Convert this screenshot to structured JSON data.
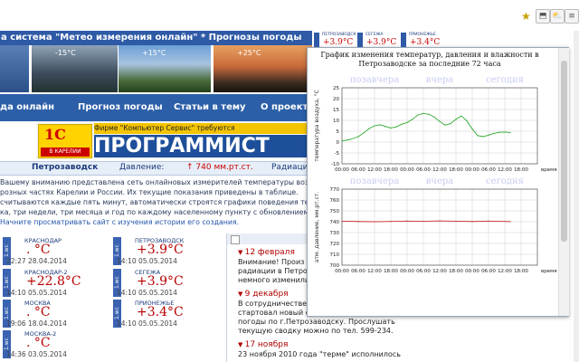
{
  "site": {
    "banner_title": "а система \"Метео измерения онлайн\" * Прогнозы погоды",
    "photos": [
      {
        "temp": "-15°C"
      },
      {
        "temp": "+15°C"
      },
      {
        "temp": "+25°C"
      }
    ],
    "nav": [
      "да онлайн",
      "Прогноз погоды",
      "Статьи в тему",
      "О проект"
    ],
    "ad": {
      "logo_text": "1С",
      "logo_sub": "В КАРЕЛИИ",
      "strip": "Фирме \"Компьютер Сервис\" требуются",
      "big": "ПРОГРАММИСТ"
    },
    "info": {
      "city": "Петрозаводск",
      "pressure_label": "Давление:",
      "pressure_value": "↑ 740 мм.рт.ст.",
      "radiation_label": "Радиацио"
    },
    "intro_lines": [
      "Вашему вниманию представлена сеть онлайновых измерителей температуры воз",
      "розных частях Карелии и России. Их текущие показания приведены в таблице.",
      "считываются каждые пять минут, автоматически строятся графики поведения темпе",
      "ка, три недели, три месяца и год по каждому населенному пункту с обновлением раз",
      "Начните просматривать сайт с изучения истории его создания."
    ]
  },
  "stations": [
    {
      "tag": "1.wc",
      "name": "КРАСНОДАР",
      "value": ". °C",
      "time": "22:27 28.04.2014"
    },
    {
      "tag": "1.wc",
      "name": "ПЕТРОЗАВОДСК",
      "value": "+3.9°C",
      "time": "14:10 05.05.2014"
    },
    {
      "tag": "1.wc",
      "name": "КРАСНОДАР-2",
      "value": "+22.8°C",
      "time": "14:10 05.05.2014"
    },
    {
      "tag": "1.wc",
      "name": "СЕГЕЖА",
      "value": "+3.9°C",
      "time": "14:10 05.05.2014"
    },
    {
      "tag": "1.wc",
      "name": "МОСКВА",
      "value": ". °C",
      "time": "19:06 18.04.2014"
    },
    {
      "tag": "1.wc",
      "name": "ПРИОНЕЖЬЕ",
      "value": "+3.4°C",
      "time": "14:10 05.05.2014"
    },
    {
      "tag": "1.wc",
      "name": "МОСКВА-2",
      "value": ". °C",
      "time": "14:36 03.05.2014"
    }
  ],
  "news": [
    {
      "date": "12 февраля",
      "text": [
        "Внимание! Произ",
        "радиации в Петро",
        "немного изменили"
      ]
    },
    {
      "date": "9 декабря",
      "text": [
        "В сотрудничестве с ООО \"Медтех\" ИКС",
        "стартовал новый сервис автоинформатора",
        "погоды по г.Петрозаводску. Прослушать",
        "текущую сводку можно по тел. 599-234."
      ]
    },
    {
      "date": "17 ноября",
      "text": [
        "23 ноября 2010 года \"терме\" исполнилось"
      ]
    }
  ],
  "badges": [
    {
      "name": "ПЕТРОЗАВОДСК",
      "value": "+3.9°C"
    },
    {
      "name": "СЕГЕЖА",
      "value": "+3.9°C"
    },
    {
      "name": "ПРИОНЕЖЬЕ",
      "value": "+3.4°C"
    }
  ],
  "chart_data": [
    {
      "type": "line",
      "title": "График изменения температур, давления и влажности в Петрозаводске за последние 72 часа",
      "ylabel": "температура воздуха, °С",
      "xlabel": "время",
      "x_ticks": [
        "00:00",
        "06:00",
        "12:00",
        "18:00",
        "00:00",
        "06:00",
        "12:00",
        "18:00",
        "00:00",
        "06:00",
        "12:00",
        "18:00"
      ],
      "day_labels": [
        "позавчера",
        "вчера",
        "сегодня"
      ],
      "yticks": [
        -10,
        -5,
        0,
        5,
        10,
        15,
        20,
        25
      ],
      "ylim": [
        -10,
        25
      ],
      "grid": true,
      "series": [
        {
          "color": "#33aa33",
          "x_hours": [
            0,
            3,
            6,
            8,
            10,
            12,
            14,
            16,
            18,
            20,
            22,
            24,
            26,
            28,
            30,
            32,
            34,
            36,
            38,
            40,
            42,
            44,
            46,
            48,
            50,
            52,
            54,
            56,
            58,
            60,
            62
          ],
          "values": [
            0.5,
            1.2,
            2.5,
            4.2,
            6.2,
            7.5,
            8.0,
            7.2,
            6.5,
            7.0,
            8.2,
            9.0,
            10.5,
            12.5,
            13.2,
            12.8,
            11.5,
            9.5,
            7.8,
            8.5,
            10.5,
            12.0,
            9.8,
            6.0,
            3.0,
            2.5,
            3.2,
            4.0,
            4.5,
            4.6,
            4.4
          ]
        }
      ]
    },
    {
      "type": "line",
      "ylabel": "атм. давление, мм.рт.ст.",
      "xlabel": "время",
      "x_ticks": [
        "00:00",
        "06:00",
        "12:00",
        "18:00",
        "00:00",
        "06:00",
        "12:00",
        "18:00",
        "00:00",
        "06:00",
        "12:00",
        "18:00"
      ],
      "day_labels": [
        "позавчера",
        "вчера",
        "сегодня"
      ],
      "yticks": [
        700,
        710,
        720,
        730,
        740,
        750,
        760,
        770
      ],
      "ylim": [
        700,
        770
      ],
      "grid": true,
      "series": [
        {
          "color": "#cc3333",
          "x_hours": [
            0,
            6,
            12,
            18,
            24,
            30,
            36,
            42,
            48,
            54,
            60,
            62
          ],
          "values": [
            740.5,
            740.2,
            740.0,
            740.3,
            740.6,
            740.4,
            740.8,
            740.5,
            740.2,
            740.6,
            740.3,
            740.1
          ]
        }
      ]
    }
  ]
}
